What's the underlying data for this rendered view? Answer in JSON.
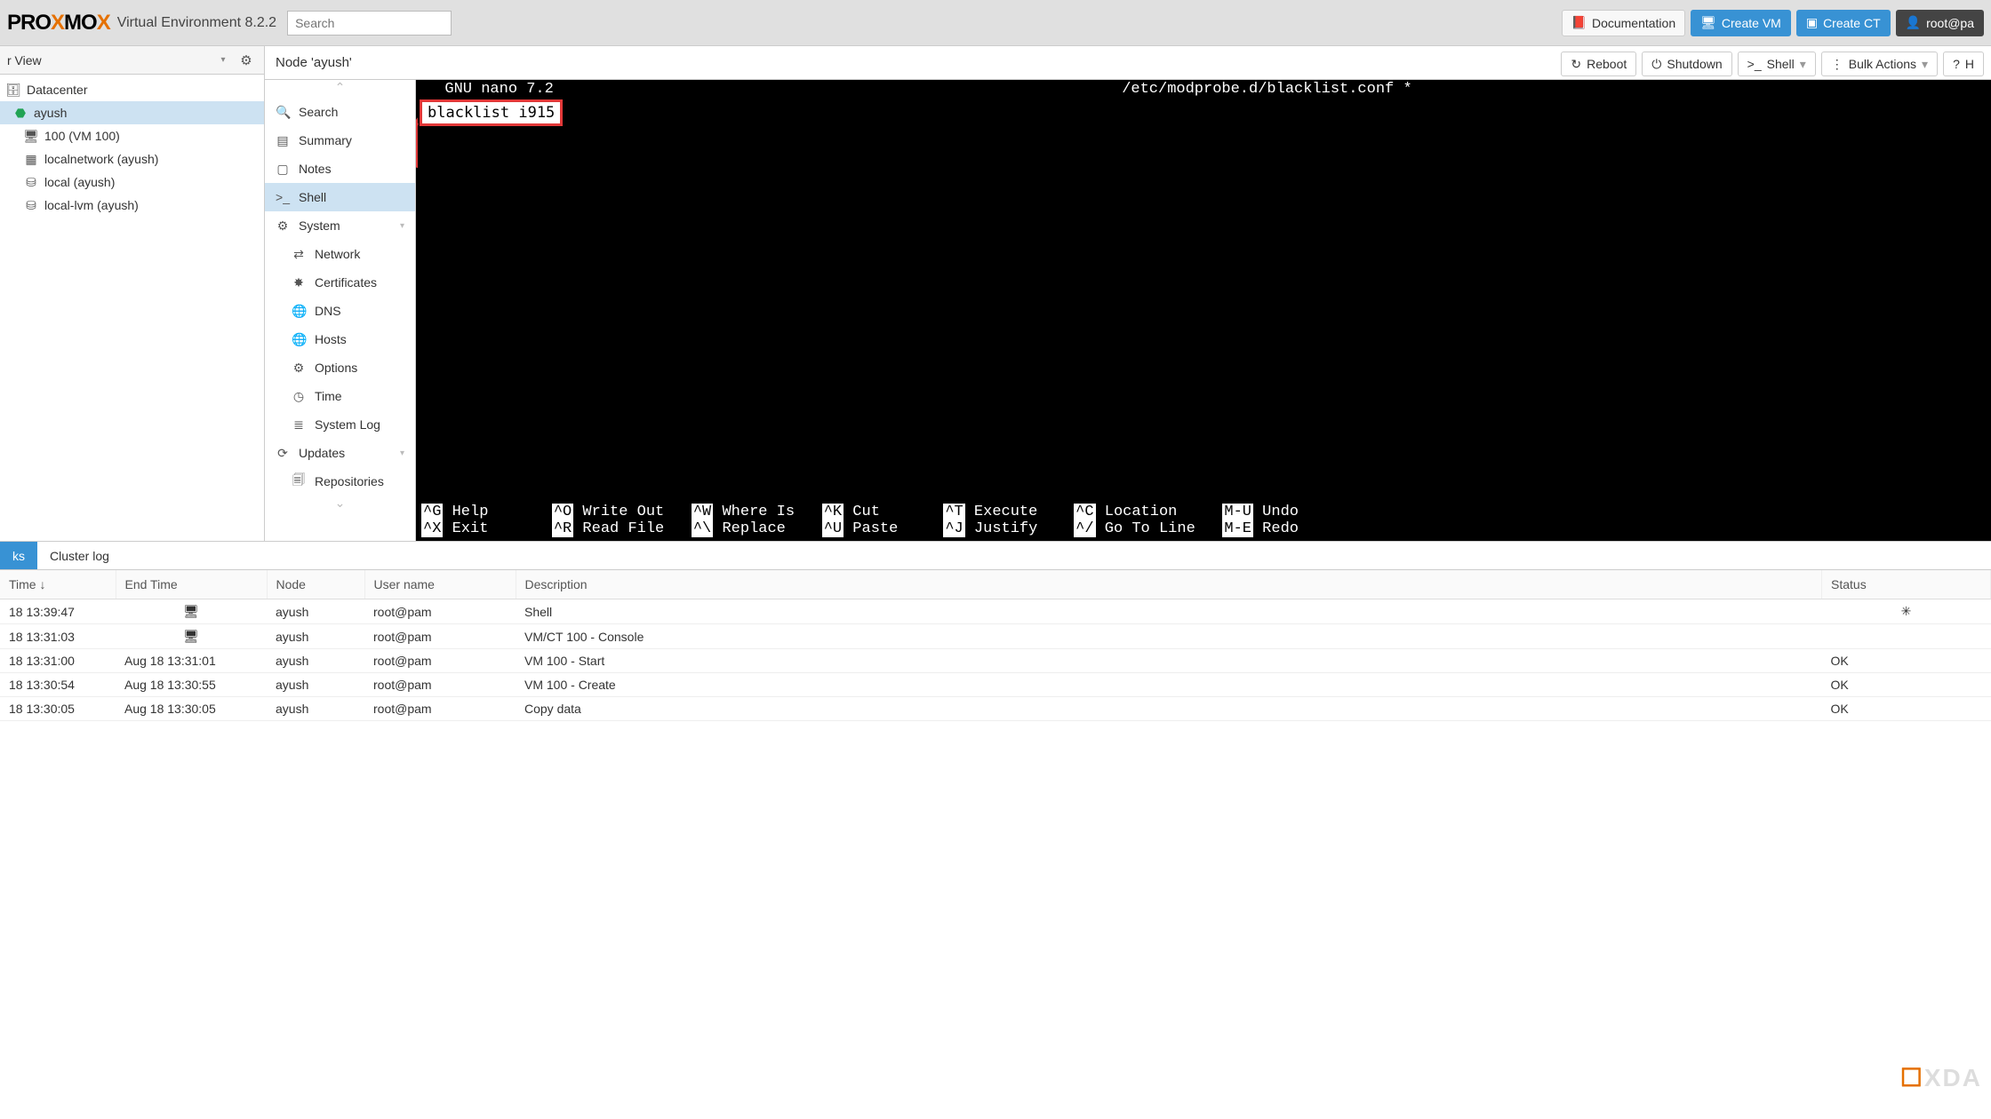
{
  "header": {
    "product_name_pre": "PRO",
    "product_name_x": "X",
    "product_name_post": "MO",
    "product_name_x2": "X",
    "ve_label": "Virtual Environment 8.2.2",
    "search_placeholder": "Search",
    "doc_label": "Documentation",
    "create_vm": "Create VM",
    "create_ct": "Create CT",
    "user_label": "root@pa"
  },
  "left": {
    "view_label": "r View",
    "tree": {
      "datacenter": "Datacenter",
      "node": "ayush",
      "vm": "100 (VM 100)",
      "localnetwork": "localnetwork (ayush)",
      "local": "local (ayush)",
      "locallvm": "local-lvm (ayush)"
    }
  },
  "node": {
    "title": "Node 'ayush'",
    "reboot": "Reboot",
    "shutdown": "Shutdown",
    "shell": "Shell",
    "bulk": "Bulk Actions",
    "help": "H"
  },
  "sidemenu": {
    "search": "Search",
    "summary": "Summary",
    "notes": "Notes",
    "shell": "Shell",
    "system": "System",
    "network": "Network",
    "certificates": "Certificates",
    "dns": "DNS",
    "hosts": "Hosts",
    "options": "Options",
    "time": "Time",
    "syslog": "System Log",
    "updates": "Updates",
    "repositories": "Repositories"
  },
  "terminal": {
    "editor_title": "  GNU nano 7.2",
    "file_path": "/etc/modprobe.d/blacklist.conf *",
    "content": "blacklist i915",
    "footer_row1": [
      {
        "k": "^G",
        "l": "Help"
      },
      {
        "k": "^O",
        "l": "Write Out"
      },
      {
        "k": "^W",
        "l": "Where Is"
      },
      {
        "k": "^K",
        "l": "Cut"
      },
      {
        "k": "^T",
        "l": "Execute"
      },
      {
        "k": "^C",
        "l": "Location"
      },
      {
        "k": "M-U",
        "l": "Undo"
      }
    ],
    "footer_row2": [
      {
        "k": "^X",
        "l": "Exit"
      },
      {
        "k": "^R",
        "l": "Read File"
      },
      {
        "k": "^\\",
        "l": "Replace"
      },
      {
        "k": "^U",
        "l": "Paste"
      },
      {
        "k": "^J",
        "l": "Justify"
      },
      {
        "k": "^/",
        "l": "Go To Line"
      },
      {
        "k": "M-E",
        "l": "Redo"
      }
    ]
  },
  "bottom": {
    "tab_tasks": "ks",
    "tab_cluster": "Cluster log",
    "columns": {
      "start": "Time ↓",
      "end": "End Time",
      "node": "Node",
      "user": "User name",
      "desc": "Description",
      "status": "Status"
    },
    "rows": [
      {
        "start": "18 13:39:47",
        "end_icon": true,
        "end": "",
        "node": "ayush",
        "user": "root@pam",
        "desc": "Shell",
        "status": "",
        "spinner": true
      },
      {
        "start": "18 13:31:03",
        "end_icon": true,
        "end": "",
        "node": "ayush",
        "user": "root@pam",
        "desc": "VM/CT 100 - Console",
        "status": ""
      },
      {
        "start": "18 13:31:00",
        "end": "Aug 18 13:31:01",
        "node": "ayush",
        "user": "root@pam",
        "desc": "VM 100 - Start",
        "status": "OK"
      },
      {
        "start": "18 13:30:54",
        "end": "Aug 18 13:30:55",
        "node": "ayush",
        "user": "root@pam",
        "desc": "VM 100 - Create",
        "status": "OK"
      },
      {
        "start": "18 13:30:05",
        "end": "Aug 18 13:30:05",
        "node": "ayush",
        "user": "root@pam",
        "desc": "Copy data",
        "status": "OK"
      }
    ]
  },
  "watermark": "XDA"
}
